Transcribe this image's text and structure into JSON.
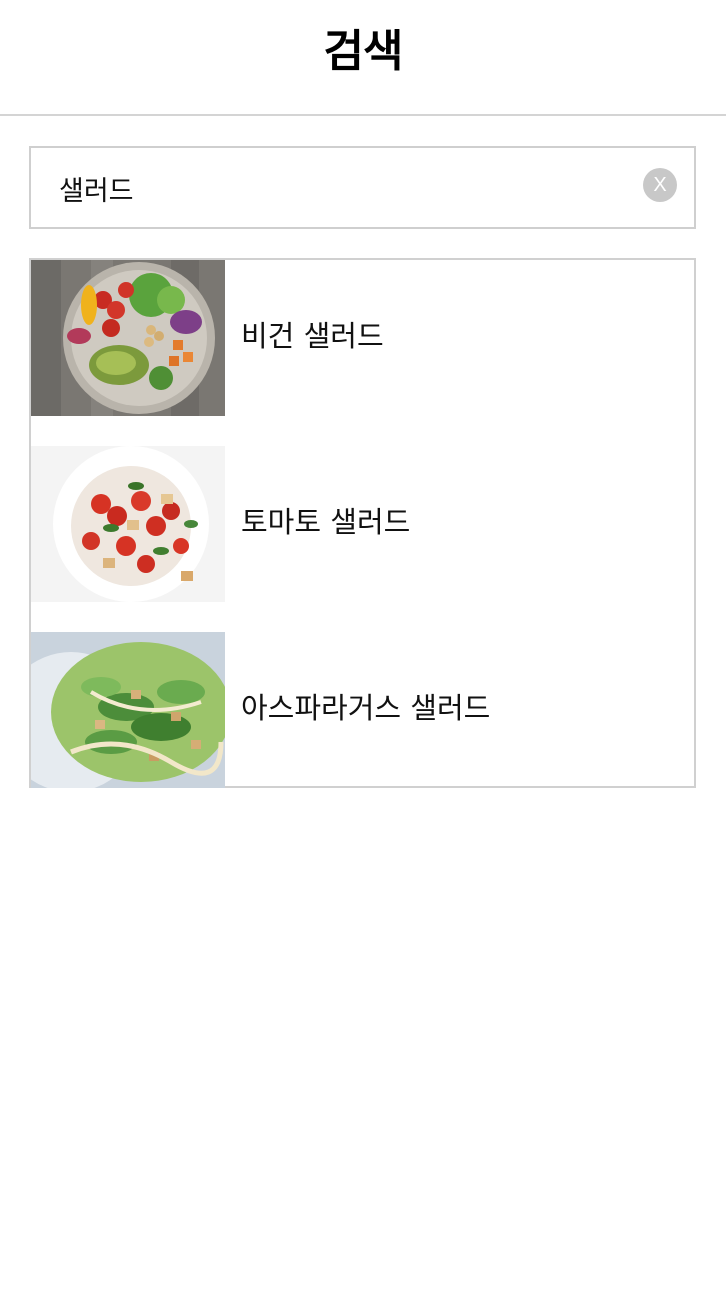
{
  "header": {
    "title": "검색"
  },
  "search": {
    "value": "샐러드",
    "clear_label": "X"
  },
  "results": [
    {
      "label": "비건 샐러드",
      "image_icon": "vegan-salad-photo"
    },
    {
      "label": "토마토 샐러드",
      "image_icon": "tomato-salad-photo"
    },
    {
      "label": "아스파라거스 샐러드",
      "image_icon": "asparagus-salad-photo"
    }
  ],
  "colors": {
    "border": "#d0d0d0",
    "clear_button_bg": "#c8c8c8",
    "text": "#111111"
  }
}
